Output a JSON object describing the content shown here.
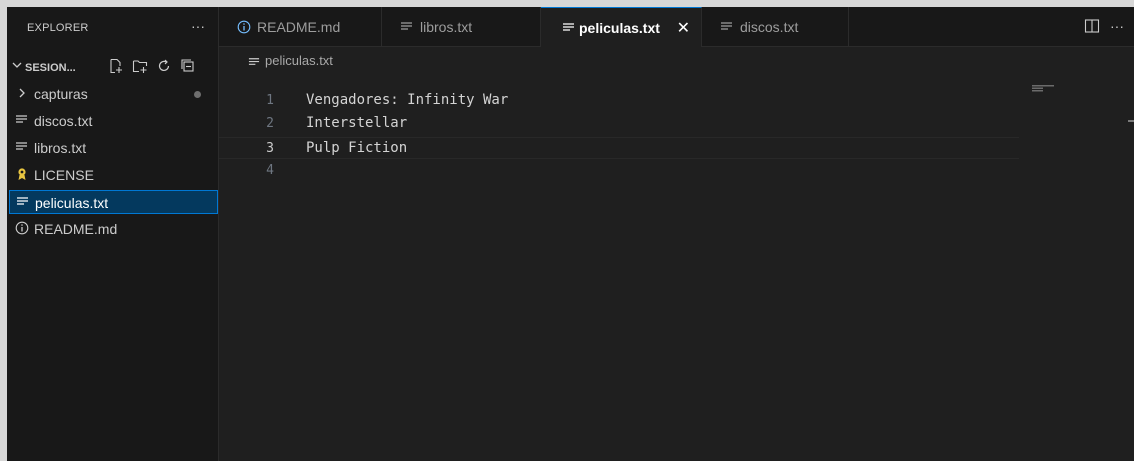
{
  "sidebar": {
    "title": "EXPLORER",
    "more_icon": "ellipsis-icon",
    "more_label": "···",
    "section": {
      "chevron": "⌄",
      "name": "SESION..."
    },
    "actions": [
      "new-file-icon",
      "new-folder-icon",
      "refresh-icon",
      "collapse-all-icon"
    ],
    "items": [
      {
        "label": "capturas",
        "icon": "chevron-right-icon",
        "type": "folder"
      },
      {
        "label": "discos.txt",
        "icon": "text-file-icon"
      },
      {
        "label": "libros.txt",
        "icon": "text-file-icon"
      },
      {
        "label": "LICENSE",
        "icon": "license-icon"
      },
      {
        "label": "peliculas.txt",
        "icon": "text-file-icon",
        "selected": true
      },
      {
        "label": "README.md",
        "icon": "info-icon"
      }
    ]
  },
  "tabs": [
    {
      "label": "README.md",
      "icon": "info-icon"
    },
    {
      "label": "libros.txt",
      "icon": "text-file-icon"
    },
    {
      "label": "peliculas.txt",
      "icon": "text-file-icon",
      "active": true,
      "close": "✕"
    },
    {
      "label": "discos.txt",
      "icon": "text-file-icon"
    }
  ],
  "tabbar_actions": {
    "split_icon": "split-editor-icon",
    "more_label": "···"
  },
  "editor": {
    "breadcrumb": "peliculas.txt",
    "lines": [
      {
        "number": "1",
        "text": "Vengadores: Infinity War"
      },
      {
        "number": "2",
        "text": "Interstellar"
      },
      {
        "number": "3",
        "text": "Pulp Fiction"
      },
      {
        "number": "4",
        "text": ""
      }
    ],
    "current_line": "3"
  },
  "colors": {
    "accent": "#0078d4",
    "selection_bg": "#04395e",
    "license_icon": "#e8c541",
    "info_icon": "#75beff"
  }
}
